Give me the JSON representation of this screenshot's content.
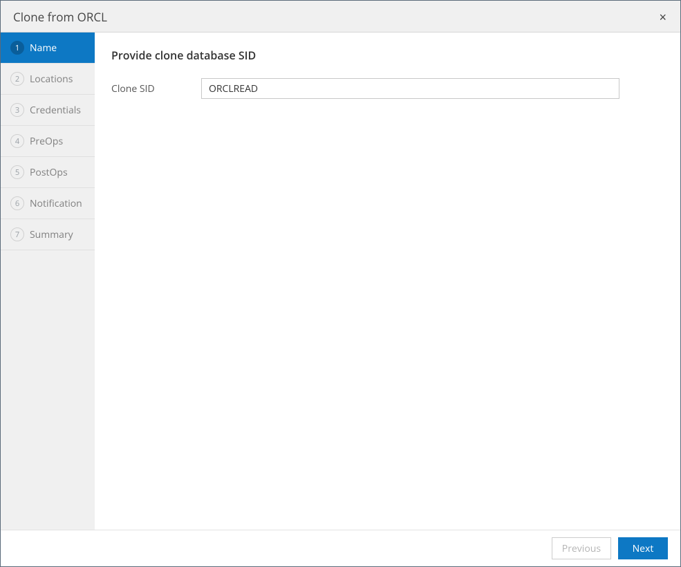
{
  "dialog": {
    "title": "Clone from ORCL",
    "close_label": "×"
  },
  "sidebar": {
    "items": [
      {
        "num": "1",
        "label": "Name",
        "active": true
      },
      {
        "num": "2",
        "label": "Locations",
        "active": false
      },
      {
        "num": "3",
        "label": "Credentials",
        "active": false
      },
      {
        "num": "4",
        "label": "PreOps",
        "active": false
      },
      {
        "num": "5",
        "label": "PostOps",
        "active": false
      },
      {
        "num": "6",
        "label": "Notification",
        "active": false
      },
      {
        "num": "7",
        "label": "Summary",
        "active": false
      }
    ]
  },
  "content": {
    "heading": "Provide clone database SID",
    "clone_sid_label": "Clone SID",
    "clone_sid_value": "ORCLREAD"
  },
  "footer": {
    "previous_label": "Previous",
    "next_label": "Next"
  }
}
